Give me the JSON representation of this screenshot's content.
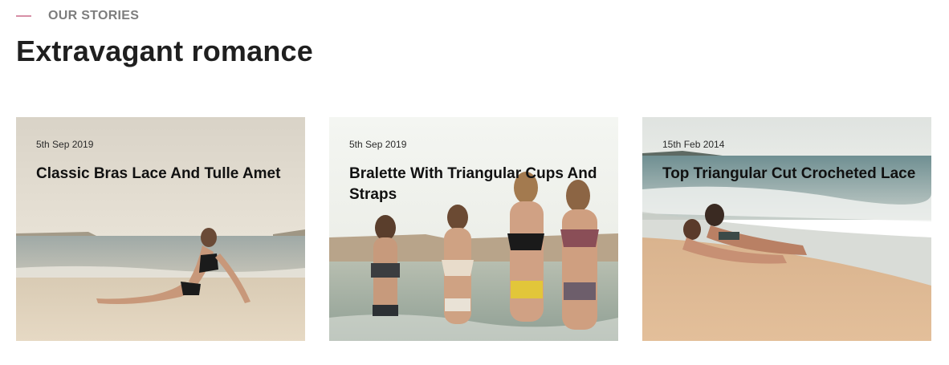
{
  "section": {
    "eyebrow": "OUR STORIES",
    "title": "Extravagant romance"
  },
  "cards": [
    {
      "date": "5th Sep 2019",
      "title": "Classic Bras Lace And Tulle Amet",
      "image_icon": "beach-photo"
    },
    {
      "date": "5th Sep 2019",
      "title": "Bralette With Triangular Cups And Straps",
      "image_icon": "beach-group-photo"
    },
    {
      "date": "15th Feb 2014",
      "title": "Top Triangular Cut Crocheted Lace",
      "image_icon": "shoreline-couple-photo"
    }
  ],
  "colors": {
    "accent": "#d78fa6",
    "eyebrow_text": "#7d7d7d",
    "title_text": "#1f1f1f"
  }
}
